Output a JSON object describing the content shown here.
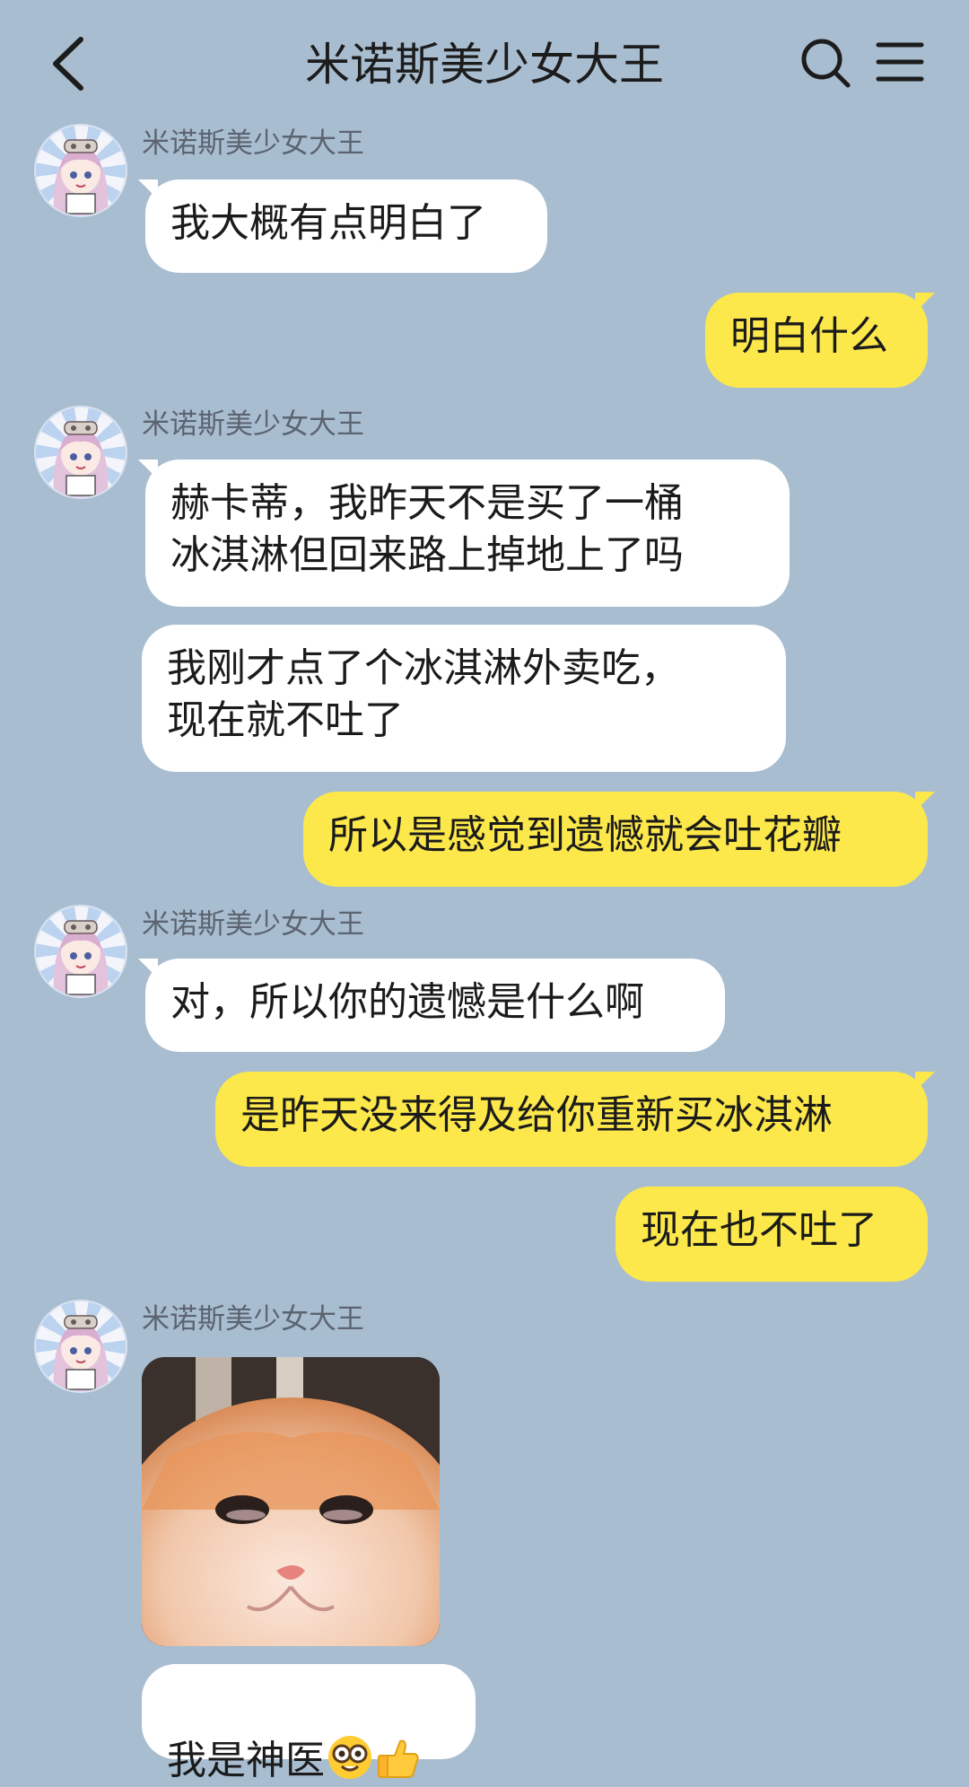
{
  "header": {
    "title": "米诺斯美少女大王",
    "back_icon": "chevron-left-icon",
    "search_icon": "search-icon",
    "menu_icon": "menu-icon"
  },
  "messages": [
    {
      "side": "left",
      "sender": "米诺斯美少女大王",
      "text": "我大概有点明白了"
    },
    {
      "side": "right",
      "text": "明白什么"
    },
    {
      "side": "left",
      "sender": "米诺斯美少女大王",
      "text": "赫卡蒂，我昨天不是买了一桶\n冰淇淋但回来路上掉地上了吗"
    },
    {
      "side": "left",
      "text": "我刚才点了个冰淇淋外卖吃，\n现在就不吐了"
    },
    {
      "side": "right",
      "text": "所以是感觉到遗憾就会吐花瓣"
    },
    {
      "side": "left",
      "sender": "米诺斯美少女大王",
      "text": "对，所以你的遗憾是什么啊"
    },
    {
      "side": "right",
      "text": "是昨天没来得及给你重新买冰淇淋"
    },
    {
      "side": "right",
      "text": "现在也不吐了"
    },
    {
      "side": "left",
      "sender": "米诺斯美少女大王",
      "type": "image",
      "image": "crying-cat-meme"
    },
    {
      "side": "left",
      "text": "我是神医",
      "emojis": [
        "nerd-face-emoji",
        "thumbs-up-emoji"
      ]
    }
  ],
  "colors": {
    "background": "#a9bdd1",
    "incoming_bubble": "#ffffff",
    "outgoing_bubble": "#fce84a",
    "sender_name": "#5b6470"
  }
}
